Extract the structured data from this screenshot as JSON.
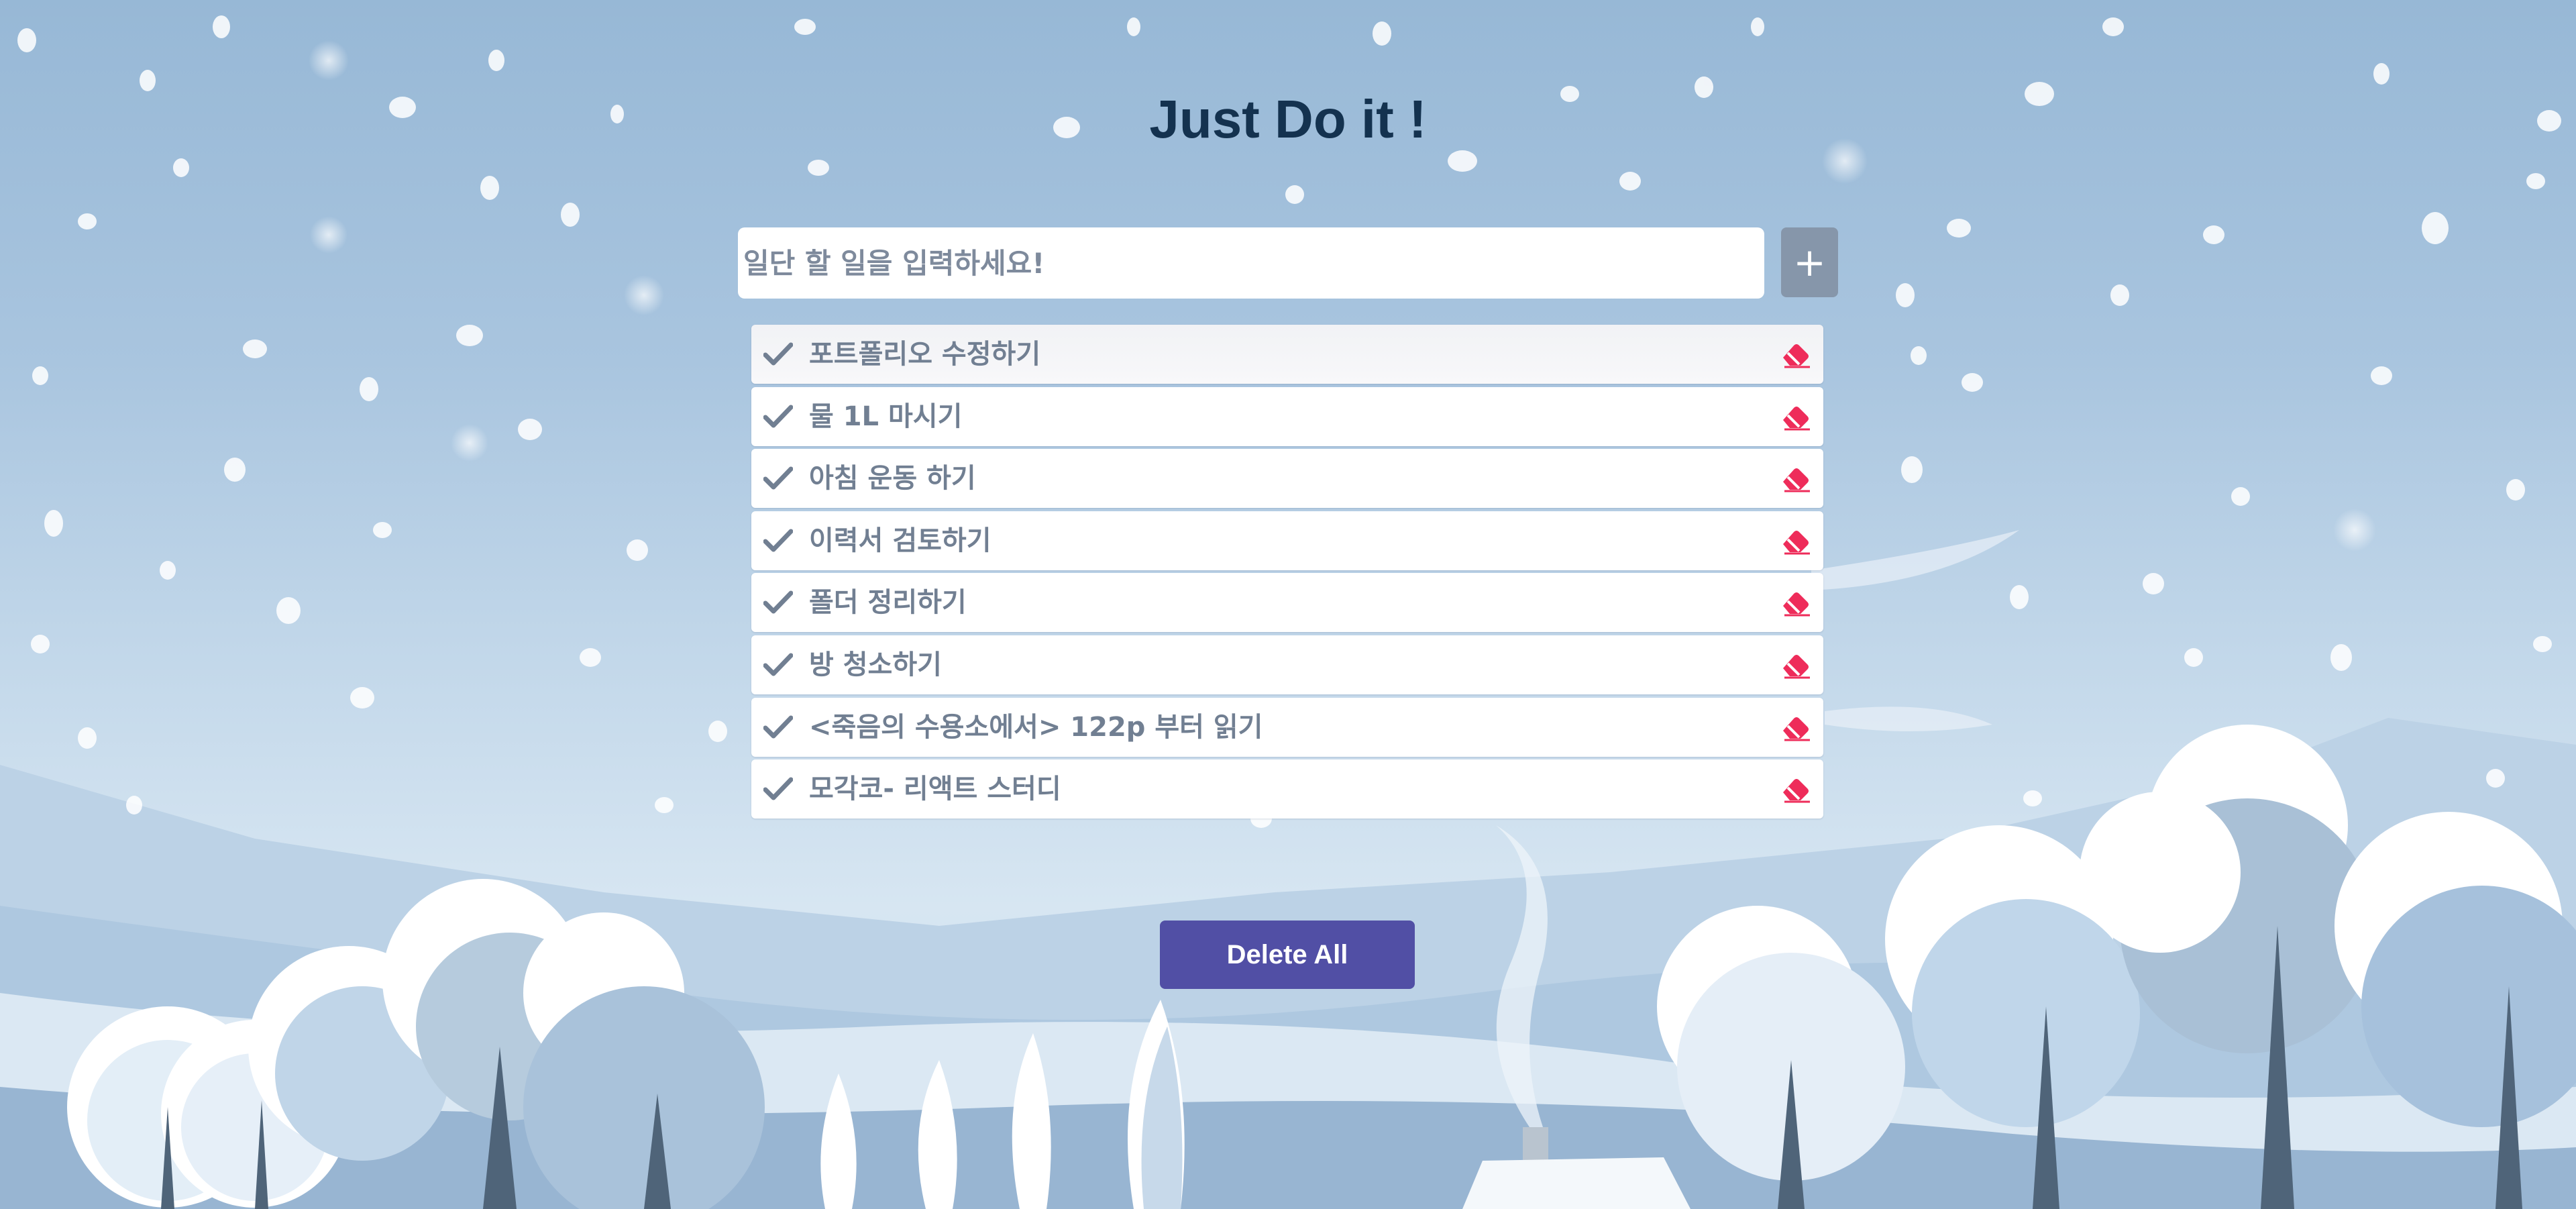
{
  "app": {
    "title": "Just Do it !"
  },
  "input": {
    "placeholder": "일단 할 일을 입력하세요!",
    "add_label": "+"
  },
  "todos": [
    {
      "text": "포트폴리오 수정하기"
    },
    {
      "text": "물 1L 마시기"
    },
    {
      "text": "아침 운동 하기"
    },
    {
      "text": "이력서 검토하기"
    },
    {
      "text": "폴더 정리하기"
    },
    {
      "text": "방 청소하기"
    },
    {
      "text": "<죽음의 수용소에서> 122p 부터 읽기"
    },
    {
      "text": "모각코- 리액트 스터디"
    }
  ],
  "footer": {
    "delete_all_label": "Delete All"
  },
  "icons": {
    "check": "check-icon",
    "delete": "eraser-icon",
    "add": "plus-icon"
  },
  "colors": {
    "title": "#14324f",
    "check": "#717f92",
    "delete": "#ee2c5a",
    "add_button": "#8696aa",
    "delete_all_button": "#514fa5"
  }
}
